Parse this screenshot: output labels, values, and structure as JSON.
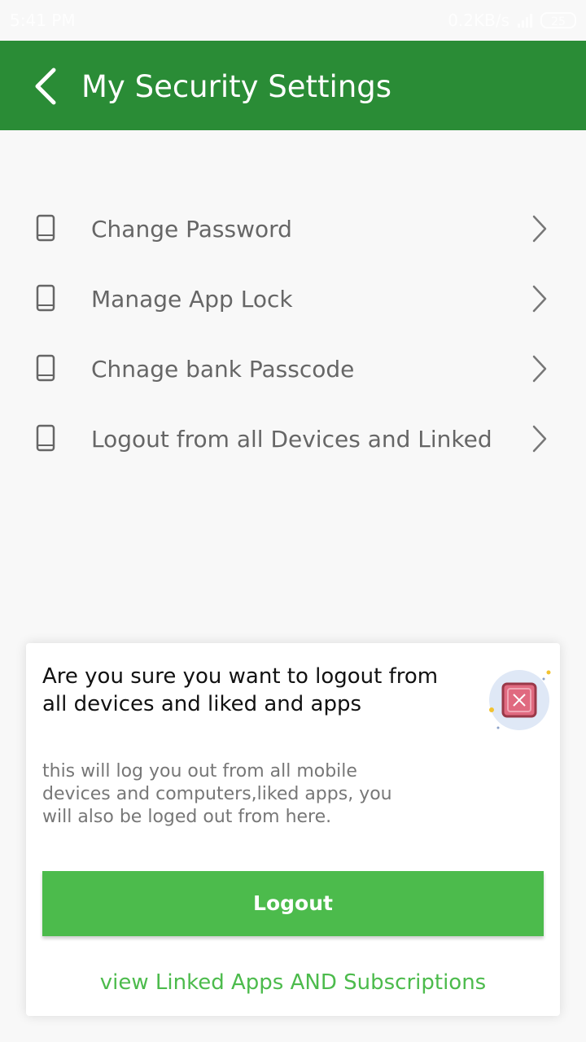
{
  "status_bar": {
    "time": "5:41 PM",
    "net_speed": "0.2KB/s",
    "battery": "25"
  },
  "header": {
    "title": "My Security Settings"
  },
  "menu": {
    "items": [
      {
        "label": "Change Password"
      },
      {
        "label": "Manage App Lock"
      },
      {
        "label": "Chnage bank Passcode"
      },
      {
        "label": "Logout from all Devices and Linked"
      }
    ]
  },
  "dialog": {
    "title": "Are you sure you want to logout from all devices and liked and apps",
    "body": "this will log you out from all mobile devices and computers,liked apps, you will also be loged out from here.",
    "logout_label": "Logout",
    "link_label": "view Linked Apps AND Subscriptions",
    "icon": "close-square-icon"
  },
  "colors": {
    "app_bar": "#2a8c36",
    "accent": "#4cbb4c",
    "label_text": "#666666"
  }
}
